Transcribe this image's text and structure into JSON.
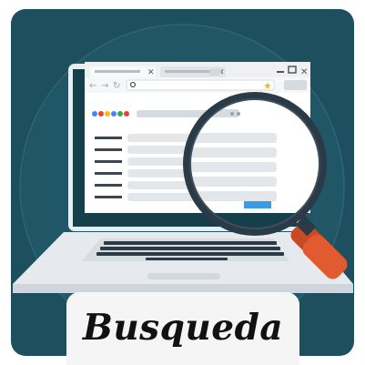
{
  "caption": "Busqueda",
  "icons": [
    "laptop-icon",
    "browser-window-icon",
    "magnifying-glass-icon",
    "back-arrow-icon",
    "forward-arrow-icon",
    "reload-icon",
    "search-icon",
    "star-icon",
    "minimize-icon",
    "maximize-icon",
    "close-icon"
  ],
  "colors": {
    "background": "#1e4f5e",
    "background_dark": "#163f4c",
    "laptop_body": "#e9edf0",
    "browser_gray": "#d6dbdf",
    "magnifier_frame": "#2b3a47",
    "magnifier_handle": "#e25a30",
    "star": "#f1b82d",
    "search_button": "#3d9be0",
    "logo_dots": [
      "#4285f4",
      "#ea4335",
      "#fbbc05",
      "#4285f4",
      "#34a853",
      "#ea4335"
    ],
    "caption_box": "#f5f5f5",
    "caption_text": "#111111"
  }
}
